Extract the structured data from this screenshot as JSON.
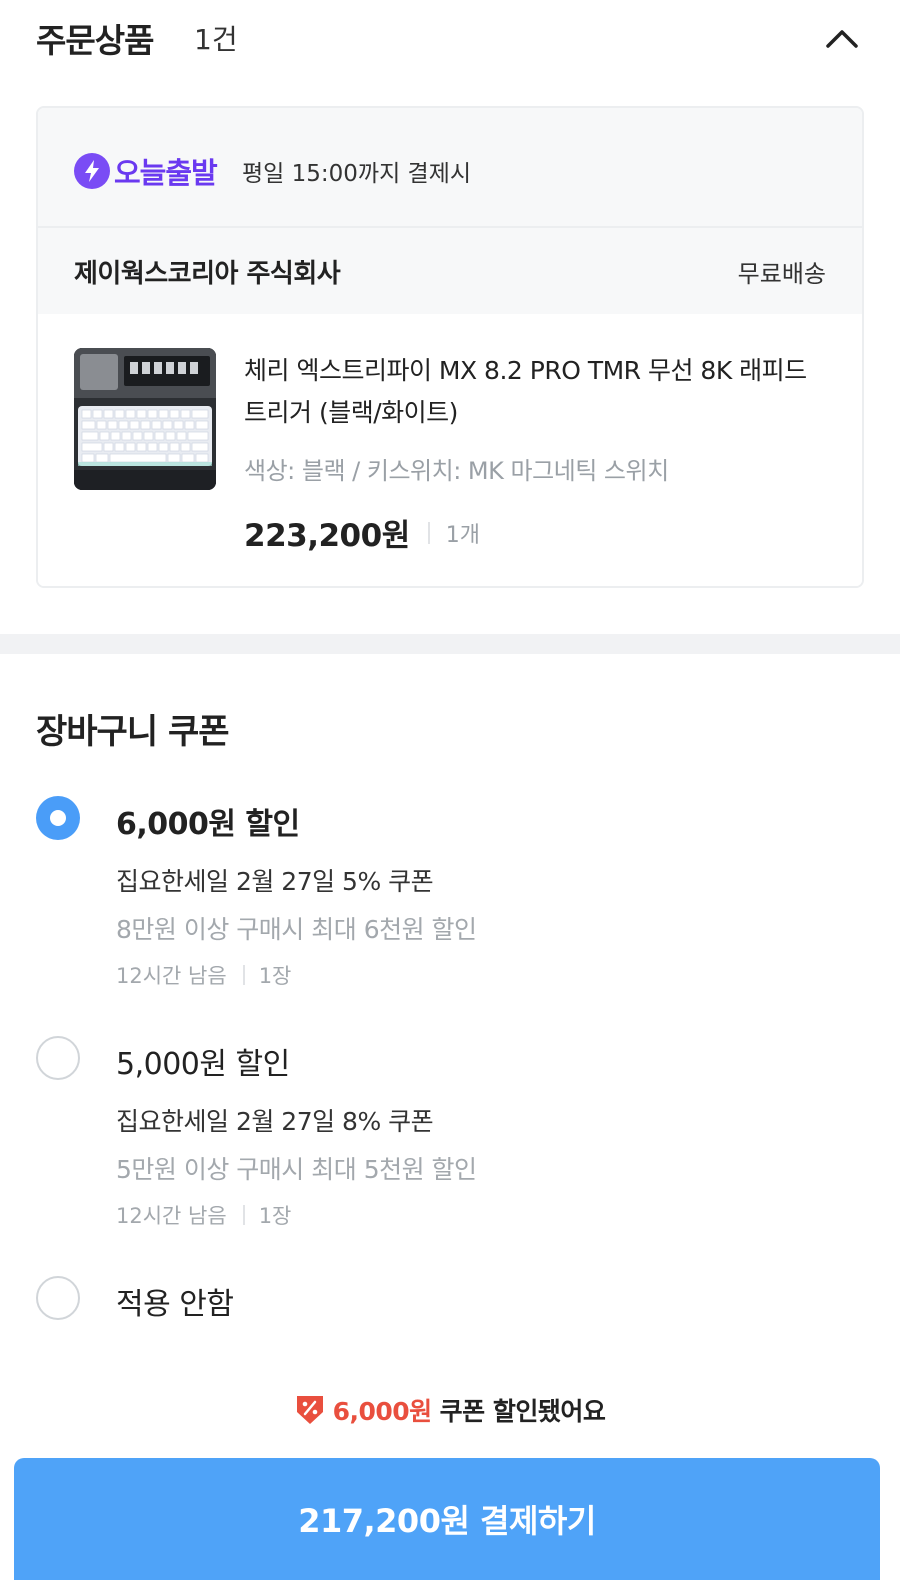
{
  "order": {
    "title": "주문상품",
    "count": "1건",
    "delivery_badge": "오늘출발",
    "delivery_note": "평일 15:00까지 결제시",
    "seller": "제이웍스코리아 주식회사",
    "shipping": "무료배송",
    "product": {
      "name": "체리 엑스트리파이 MX 8.2 PRO TMR 무선 8K 래피드 트리거 (블랙/화이트)",
      "option": "색상: 블랙 / 키스위치: MK 마그네틱 스위치",
      "price": "223,200원",
      "quantity": "1개"
    }
  },
  "coupons": {
    "title": "장바구니 쿠폰",
    "options": [
      {
        "amount": "6,000원 할인",
        "name": "집요한세일 2월 27일 5% 쿠폰",
        "condition": "8만원 이상 구매시 최대 6천원 할인",
        "remaining": "12시간 남음",
        "count": "1장",
        "selected": true
      },
      {
        "amount": "5,000원 할인",
        "name": "집요한세일 2월 27일 8% 쿠폰",
        "condition": "5만원 이상 구매시 최대 5천원 할인",
        "remaining": "12시간 남음",
        "count": "1장",
        "selected": false
      },
      {
        "amount": "적용 안함",
        "selected": false
      }
    ]
  },
  "summary": {
    "discount_amount": "6,000원",
    "discount_text": "쿠폰 할인됐어요",
    "pay_button": "217,200원 결제하기"
  },
  "colors": {
    "accent": "#4fa3f8",
    "radio_selected": "#4a9df8",
    "badge_purple": "#6a39f0",
    "discount_red": "#e94f3e"
  }
}
